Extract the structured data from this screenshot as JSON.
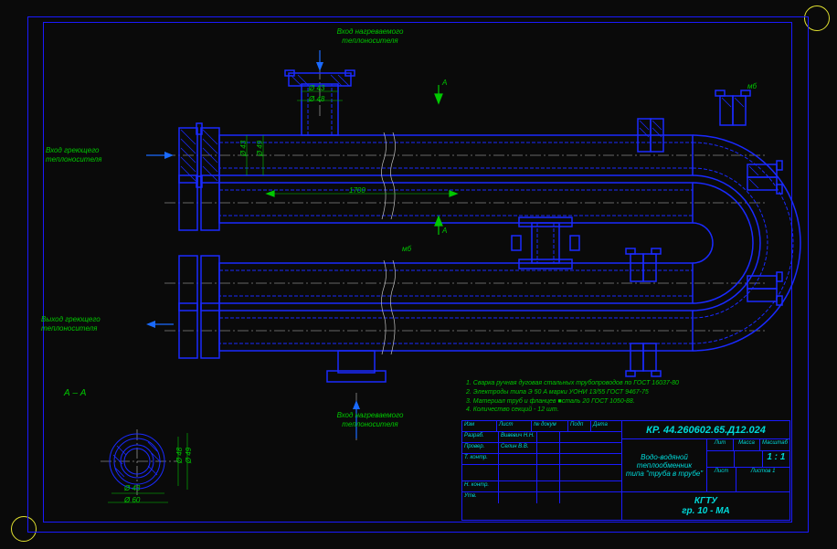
{
  "labels": {
    "input_heated_top": "Вход нагреваемого теплоносителя",
    "input_heating_left": "Вход греющего теплоносителя",
    "output_heating_left": "Выход греющего теплоносителя",
    "input_heated_bottom": "Вход нагреваемого теплоносителя",
    "section": "А – А",
    "section_marker_a": "А",
    "bolt_marker": "мб"
  },
  "dimensions": {
    "length_main": "1700",
    "d43": "Ø 43",
    "d48": "Ø 48",
    "d49": "Ø 49",
    "d43_v": "Ø 43",
    "sec_d43": "Ø 43",
    "sec_d48": "Ø 48",
    "sec_d49": "Ø 49",
    "sec_d60": "Ø 60"
  },
  "notes": {
    "n1": "1. Сварка ручная дуговая стальных трубопроводов по ГОСТ 16037-80",
    "n2": "2. Электроды типа Э 50 А марки УОНИ 13/55 ГОСТ 9467-75",
    "n3": "3. Материал труб и фланцев ■сталь 20 ГОСТ 1050-88.",
    "n4": "4. Количество секций - 12 шт."
  },
  "title_block": {
    "doc_number": "КР. 44.260602.65.Д12.024",
    "description1": "Водо-водяной теплообменник",
    "description2": "типа \"труба в трубе\"",
    "headers": {
      "izm": "Изм",
      "list": "Лист",
      "ndokum": "№ докум",
      "podp": "Подп",
      "data": "Дата"
    },
    "rows": {
      "razrab_label": "Разраб.",
      "razrab_name": "Вивевич Н.Н.",
      "prover_label": "Провер.",
      "prover_name": "Селин В.В.",
      "tkontr_label": "Т. контр.",
      "nkontr_label": "Н. контр.",
      "utv_label": "Утв."
    },
    "meta": {
      "lit": "Лит",
      "massa": "Масса",
      "mashtab": "Масштаб",
      "mashtab_val": "1 : 1",
      "list": "Лист",
      "listov": "Листов 1"
    },
    "org1": "КГТУ",
    "org2": "гр. 10 - МА"
  }
}
